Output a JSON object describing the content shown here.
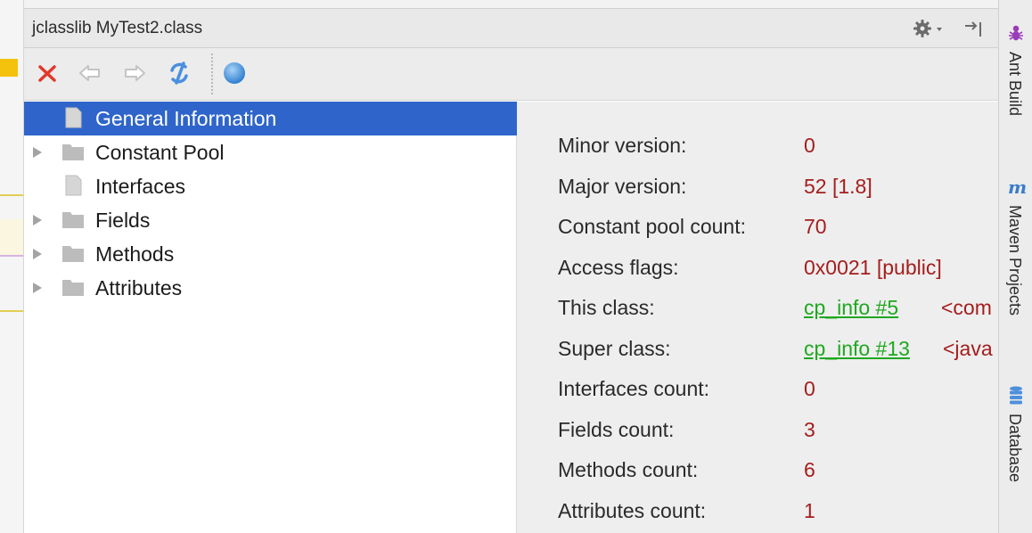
{
  "window": {
    "title": "jclasslib MyTest2.class"
  },
  "header_icons": {
    "gear": "gear-icon",
    "dropdown": "chevron-down-icon",
    "hide": "hide-panel-icon"
  },
  "toolbar": {
    "buttons": [
      {
        "icon": "close-icon",
        "color": "#e0392b"
      },
      {
        "icon": "back-arrow-icon",
        "color": "#c9c9c9"
      },
      {
        "icon": "forward-arrow-icon",
        "color": "#c9c9c9"
      },
      {
        "icon": "refresh-icon",
        "color": "#4a8fe0"
      },
      {
        "icon": "browser-globe-icon",
        "color": "#3f8fd9"
      }
    ]
  },
  "tree": {
    "items": [
      {
        "label": "General Information",
        "selected": true,
        "expandable": false,
        "icon": "file-icon"
      },
      {
        "label": "Constant Pool",
        "selected": false,
        "expandable": true,
        "icon": "folder-icon"
      },
      {
        "label": "Interfaces",
        "selected": false,
        "expandable": false,
        "icon": "file-icon"
      },
      {
        "label": "Fields",
        "selected": false,
        "expandable": true,
        "icon": "folder-icon"
      },
      {
        "label": "Methods",
        "selected": false,
        "expandable": true,
        "icon": "folder-icon"
      },
      {
        "label": "Attributes",
        "selected": false,
        "expandable": true,
        "icon": "folder-icon"
      }
    ]
  },
  "details": {
    "rows": [
      {
        "key": "Minor version:",
        "value": "0"
      },
      {
        "key": "Major version:",
        "value": "52 [1.8]"
      },
      {
        "key": "Constant pool count:",
        "value": "70"
      },
      {
        "key": "Access flags:",
        "value": "0x0021 [public]"
      },
      {
        "key": "This class:",
        "link": "cp_info #5",
        "extra": "<com"
      },
      {
        "key": "Super class:",
        "link": "cp_info #13",
        "extra": "<java"
      },
      {
        "key": "Interfaces count:",
        "value": "0"
      },
      {
        "key": "Fields count:",
        "value": "3"
      },
      {
        "key": "Methods count:",
        "value": "6"
      },
      {
        "key": "Attributes count:",
        "value": "1"
      }
    ]
  },
  "right_strip": {
    "tabs": [
      {
        "label": "Ant Build",
        "icon": "ant-icon"
      },
      {
        "label": "Maven Projects",
        "icon": "maven-icon"
      },
      {
        "label": "Database",
        "icon": "database-icon"
      }
    ]
  },
  "colors": {
    "selection": "#2f65ca",
    "value_red": "#a51d1d",
    "link_green": "#1fa81f"
  }
}
